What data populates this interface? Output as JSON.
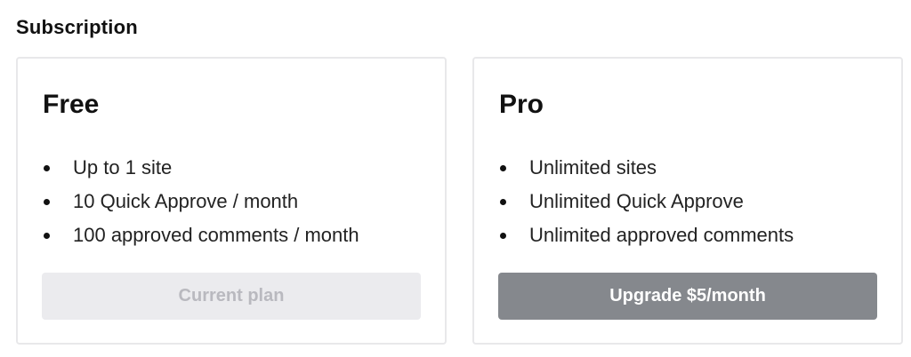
{
  "subscription": {
    "title": "Subscription",
    "plans": [
      {
        "name": "Free",
        "features": [
          "Up to 1 site",
          "10 Quick Approve / month",
          "100 approved comments / month"
        ],
        "button_label": "Current plan"
      },
      {
        "name": "Pro",
        "features": [
          "Unlimited sites",
          "Unlimited Quick Approve",
          "Unlimited approved comments"
        ],
        "button_label": "Upgrade $5/month"
      }
    ]
  },
  "colors": {
    "card_border": "#e8e8ea",
    "disabled_button": "#ebebee",
    "disabled_text": "#b9b9bf",
    "primary_button": "#85888d"
  }
}
